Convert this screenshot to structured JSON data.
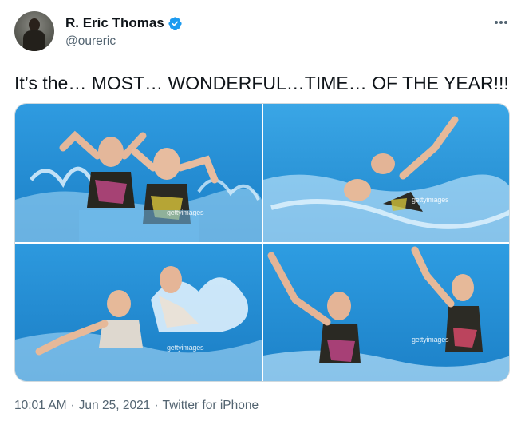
{
  "author": {
    "display_name": "R. Eric Thomas",
    "handle": "@oureric",
    "verified_icon": "verified-badge-icon"
  },
  "tweet": {
    "text": "It’s the… MOST… WONDERFUL…TIME… OF THE YEAR!!!"
  },
  "media": {
    "watermarks": [
      "gettyimages",
      "gettyimages",
      "gettyimages",
      "gettyimages"
    ]
  },
  "meta": {
    "time": "10:01 AM",
    "separator": "·",
    "date": "Jun 25, 2021",
    "source": "Twitter for iPhone"
  },
  "colors": {
    "verified": "#1d9bf0",
    "text_primary": "#0f1419",
    "text_secondary": "#536471",
    "pool_water": "#1a8fd6"
  }
}
